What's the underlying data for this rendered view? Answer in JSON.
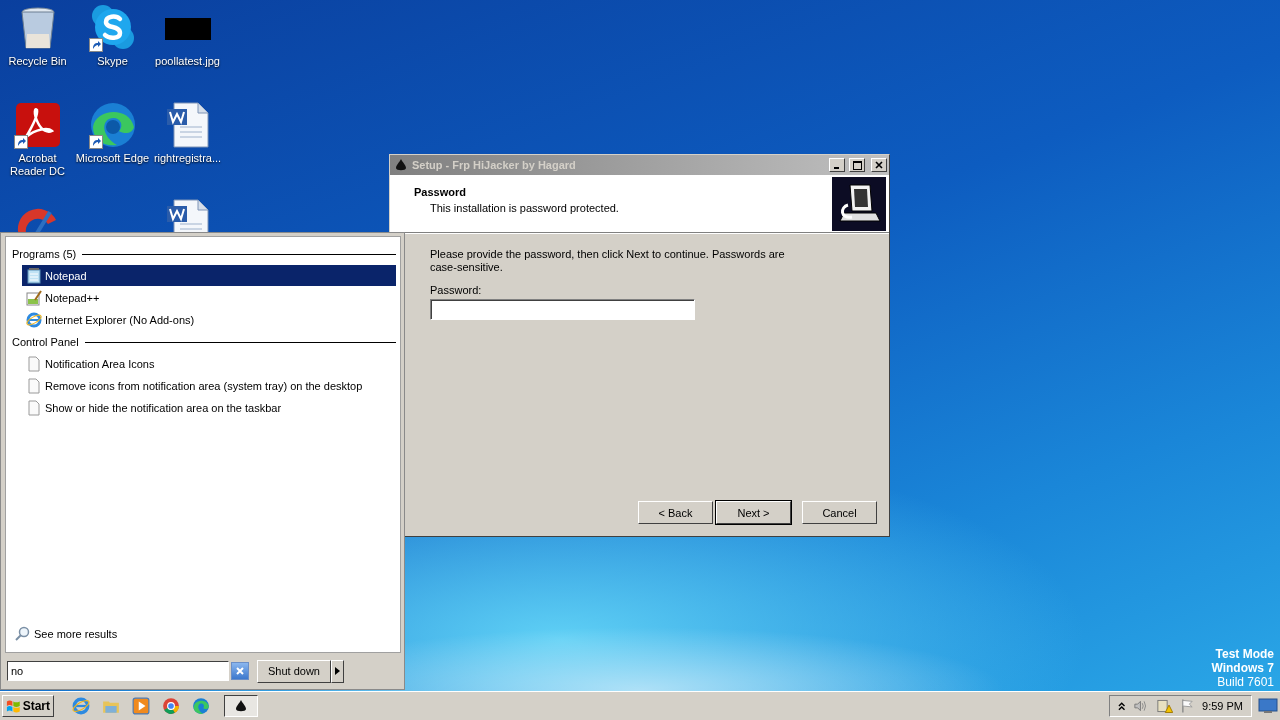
{
  "desktop_icons": [
    {
      "kind": "recycle",
      "label": "Recycle Bin",
      "shortcut": false
    },
    {
      "kind": "skype",
      "label": "Skype",
      "shortcut": true
    },
    {
      "kind": "image",
      "label": "poollatest.jpg",
      "shortcut": false
    },
    {
      "kind": "acrobat",
      "label": "Acrobat Reader DC",
      "shortcut": true
    },
    {
      "kind": "edge",
      "label": "Microsoft Edge",
      "shortcut": true
    },
    {
      "kind": "word",
      "label": "rightregistra...",
      "shortcut": false
    },
    {
      "kind": "cleaner"
    },
    {
      "kind": "word"
    }
  ],
  "start_menu": {
    "groups": [
      {
        "title": "Programs (5)",
        "items": [
          {
            "label": "Notepad",
            "kind": "notepad",
            "selected": true
          },
          {
            "label": "Notepad++",
            "kind": "notepadpp",
            "selected": false
          },
          {
            "label": "Internet Explorer (No Add-ons)",
            "kind": "ie",
            "selected": false
          }
        ]
      },
      {
        "title": "Control Panel",
        "items": [
          {
            "label": "Notification Area Icons",
            "kind": "page",
            "selected": false
          },
          {
            "label": "Remove icons from notification area (system tray) on the desktop",
            "kind": "page",
            "selected": false
          },
          {
            "label": "Show or hide the notification area on the taskbar",
            "kind": "page",
            "selected": false
          }
        ]
      }
    ],
    "see_more": "See more results",
    "search": {
      "value": "no"
    },
    "shutdown": "Shut down"
  },
  "dialog": {
    "title": "Setup - Frp HiJacker by Hagard",
    "active": false,
    "heading": "Password",
    "subheading": "This installation is password protected.",
    "instructions": "Please provide the password, then click Next to continue. Passwords are case-sensitive.",
    "password_label": "Password:",
    "buttons": [
      {
        "label": "< Back",
        "default": false
      },
      {
        "label": "Next >",
        "default": true
      },
      {
        "label": "Cancel",
        "default": false
      }
    ]
  },
  "taskbar": {
    "start": "Start",
    "quick_launch": [
      {
        "kind": "ie"
      },
      {
        "kind": "folder"
      },
      {
        "kind": "media"
      },
      {
        "kind": "chrome"
      },
      {
        "kind": "edge"
      }
    ],
    "tasks": [
      {
        "kind": "setup"
      }
    ],
    "tray": [
      {
        "kind": "chevron"
      },
      {
        "kind": "speaker"
      },
      {
        "kind": "network"
      },
      {
        "kind": "flag"
      }
    ],
    "clock": "9:59 PM"
  },
  "system_watermark": [
    "Test Mode",
    "Windows 7",
    "Build 7601"
  ]
}
